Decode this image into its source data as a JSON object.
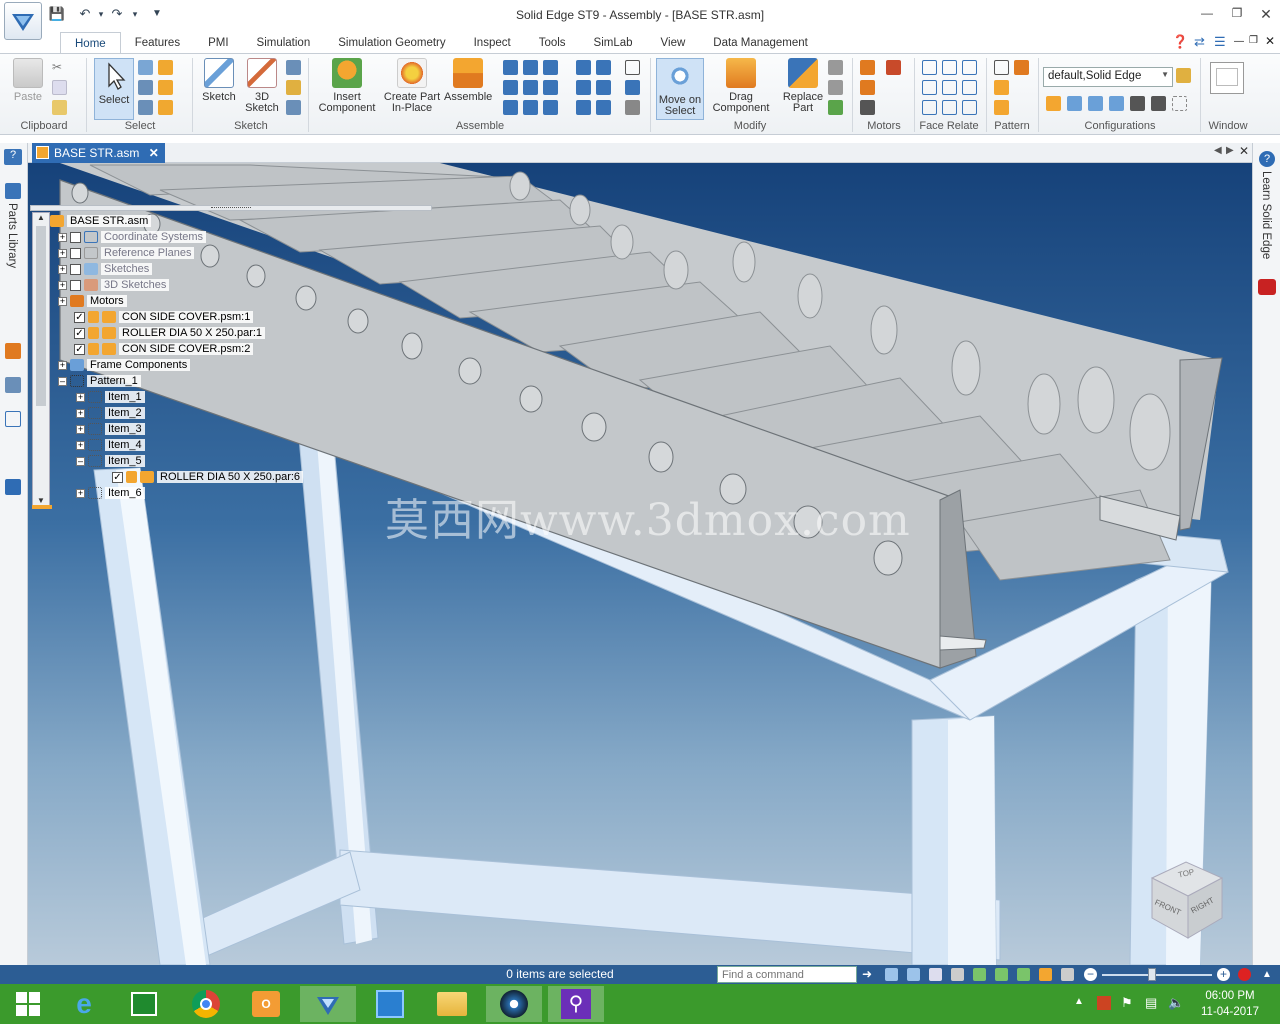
{
  "window": {
    "title": "Solid Edge ST9 - Assembly - [BASE STR.asm]"
  },
  "tabs": [
    "Home",
    "Features",
    "PMI",
    "Simulation",
    "Simulation Geometry",
    "Inspect",
    "Tools",
    "SimLab",
    "View",
    "Data Management"
  ],
  "active_tab": "Home",
  "ribbon": {
    "clipboard": {
      "label": "Clipboard",
      "paste": "Paste"
    },
    "select": {
      "label": "Select",
      "select_btn": "Select"
    },
    "sketch": {
      "label": "Sketch",
      "sketch_btn": "Sketch",
      "sketch3d_l1": "3D",
      "sketch3d_l2": "Sketch"
    },
    "assemble": {
      "label": "Assemble",
      "insert_l1": "Insert",
      "insert_l2": "Component",
      "create_l1": "Create Part",
      "create_l2": "In-Place",
      "assemble_btn": "Assemble"
    },
    "modify": {
      "label": "Modify",
      "move_l1": "Move on",
      "move_l2": "Select",
      "drag_l1": "Drag",
      "drag_l2": "Component",
      "replace_l1": "Replace",
      "replace_l2": "Part"
    },
    "motors": {
      "label": "Motors"
    },
    "face_relate": {
      "label": "Face Relate"
    },
    "pattern": {
      "label": "Pattern"
    },
    "configurations": {
      "label": "Configurations",
      "current": "default,Solid Edge"
    },
    "window": {
      "label": "Window"
    }
  },
  "side": {
    "parts_library": "Parts Library",
    "learn": "Learn Solid Edge"
  },
  "document_tab": "BASE STR.asm",
  "tree": {
    "root": "BASE STR.asm",
    "items": [
      {
        "label": "Coordinate Systems",
        "dim": true
      },
      {
        "label": "Reference Planes",
        "dim": true
      },
      {
        "label": "Sketches",
        "dim": true
      },
      {
        "label": "3D Sketches",
        "dim": true
      },
      {
        "label": "Motors",
        "dim": false
      },
      {
        "label": "CON SIDE COVER.psm:1",
        "dim": false
      },
      {
        "label": "ROLLER DIA 50 X 250.par:1",
        "dim": false
      },
      {
        "label": "CON SIDE COVER.psm:2",
        "dim": false
      },
      {
        "label": "Frame Components",
        "dim": false
      },
      {
        "label": "Pattern_1",
        "dim": false
      },
      {
        "label": "Item_1",
        "dim": false
      },
      {
        "label": "Item_2",
        "dim": false
      },
      {
        "label": "Item_3",
        "dim": false
      },
      {
        "label": "Item_4",
        "dim": false
      },
      {
        "label": "Item_5",
        "dim": false
      },
      {
        "label": "ROLLER DIA 50 X 250.par:6",
        "dim": false
      },
      {
        "label": "Item_6",
        "dim": false
      }
    ]
  },
  "viewcube": {
    "top": "TOP",
    "front": "FRONT",
    "right": "RIGHT"
  },
  "watermark": "莫西网www.3dmox.com",
  "status": {
    "selection": "0 items are selected",
    "find_placeholder": "Find a command"
  },
  "taskbar": {
    "time": "06:00 PM",
    "date": "11-04-2017"
  },
  "colors": {
    "ribbon_accent": "#2f6cb4",
    "status_bar": "#2c5d94",
    "taskbar": "#3b9a2c",
    "frame": "#dce9f7",
    "conveyor": "#b4b9be"
  }
}
